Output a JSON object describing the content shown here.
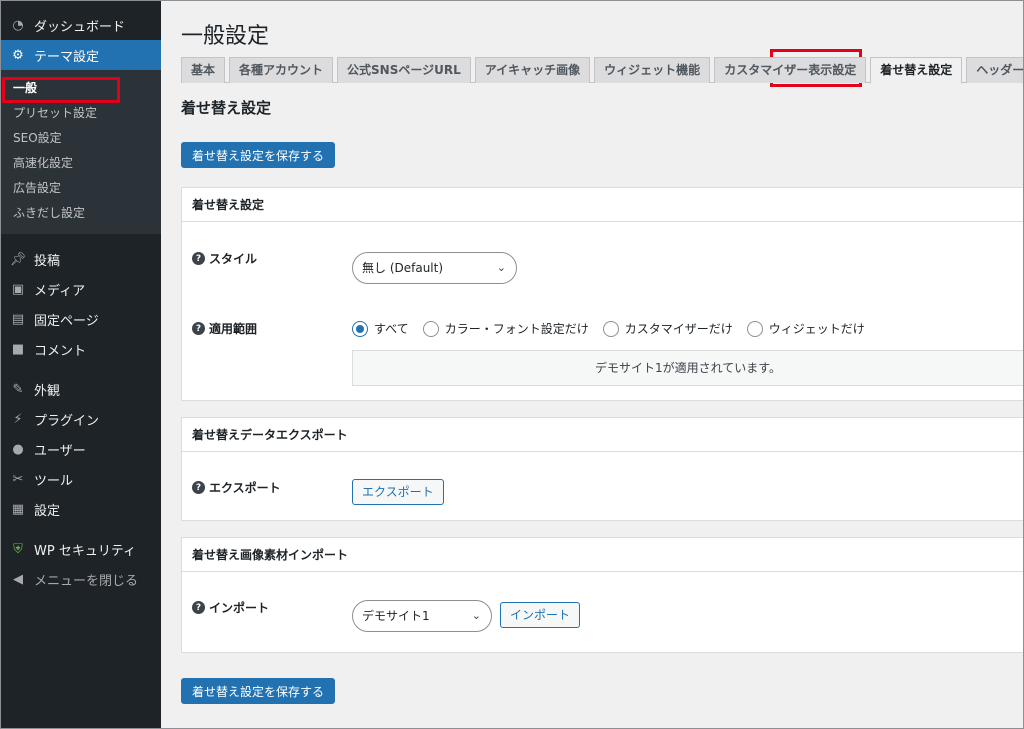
{
  "sidebar": {
    "top_items": [
      {
        "label": "ダッシュボード",
        "icon": "dashboard-icon"
      },
      {
        "label": "テーマ設定",
        "icon": "gear-icon",
        "current": true
      }
    ],
    "submenu": [
      "一般",
      "プリセット設定",
      "SEO設定",
      "高速化設定",
      "広告設定",
      "ふきだし設定"
    ],
    "items_group1": [
      {
        "label": "投稿",
        "icon": "pin-icon"
      },
      {
        "label": "メディア",
        "icon": "media-icon"
      },
      {
        "label": "固定ページ",
        "icon": "page-icon"
      },
      {
        "label": "コメント",
        "icon": "comment-icon"
      }
    ],
    "items_group2": [
      {
        "label": "外観",
        "icon": "brush-icon"
      },
      {
        "label": "プラグイン",
        "icon": "plugin-icon"
      },
      {
        "label": "ユーザー",
        "icon": "user-icon"
      },
      {
        "label": "ツール",
        "icon": "wrench-icon"
      },
      {
        "label": "設定",
        "icon": "settings-icon"
      }
    ],
    "security": {
      "label": "WP セキュリティ",
      "icon": "shield-icon"
    },
    "collapse": {
      "label": "メニューを閉じる",
      "icon": "collapse-icon"
    }
  },
  "page": {
    "title": "一般設定",
    "tabs": [
      "基本",
      "各種アカウント",
      "公式SNSページURL",
      "アイキャッチ画像",
      "ウィジェット機能",
      "カスタマイザー表示設定",
      "着せ替え設定",
      "ヘッダー・フッター自由入力"
    ],
    "active_tab": 6,
    "section_title": "着せ替え設定",
    "save_label": "着せ替え設定を保存する"
  },
  "panel_skin": {
    "title": "着せ替え設定",
    "style_label": "スタイル",
    "style_value": "無し (Default)",
    "scope_label": "適用範囲",
    "scope_options": [
      "すべて",
      "カラー・フォント設定だけ",
      "カスタマイザーだけ",
      "ウィジェットだけ"
    ],
    "scope_selected": 0,
    "notice": "デモサイト1が適用されています。"
  },
  "panel_export": {
    "title": "着せ替えデータエクスポート",
    "label": "エクスポート",
    "button": "エクスポート"
  },
  "panel_import": {
    "title": "着せ替え画像素材インポート",
    "label": "インポート",
    "select_value": "デモサイト1",
    "button": "インポート"
  },
  "colors": {
    "sidebar_bg": "#1d2327",
    "accent": "#2271b1",
    "highlight_box": "#e2001a"
  }
}
